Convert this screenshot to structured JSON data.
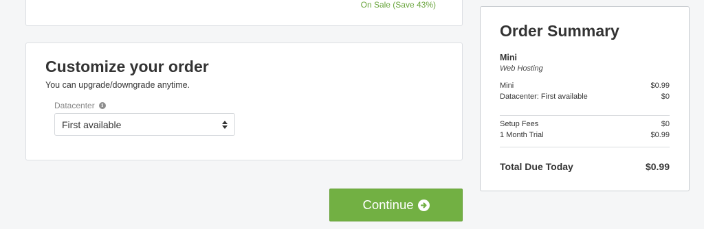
{
  "top_panel": {
    "sale_text": "On Sale (Save 43%)"
  },
  "customize": {
    "title": "Customize your order",
    "subtitle": "You can upgrade/downgrade anytime.",
    "datacenter_label": "Datacenter",
    "datacenter_value": "First available"
  },
  "continue_button": {
    "label": "Continue"
  },
  "summary": {
    "title": "Order Summary",
    "product_name": "Mini",
    "product_group": "Web Hosting",
    "lines": [
      {
        "label": "Mini",
        "amount": "$0.99"
      },
      {
        "label": "Datacenter: First available",
        "amount": "$0"
      }
    ],
    "fees": [
      {
        "label": "Setup Fees",
        "amount": "$0"
      },
      {
        "label": "1 Month Trial",
        "amount": "$0.99"
      }
    ],
    "total_label": "Total Due Today",
    "total_amount": "$0.99"
  },
  "colors": {
    "accent_green": "#72b043",
    "sale_green": "#69a43c",
    "background": "#f5f6f7"
  },
  "icons": {
    "info": "info-icon",
    "continue": "arrow-circle-right-icon",
    "select": "sort-arrows-icon"
  }
}
